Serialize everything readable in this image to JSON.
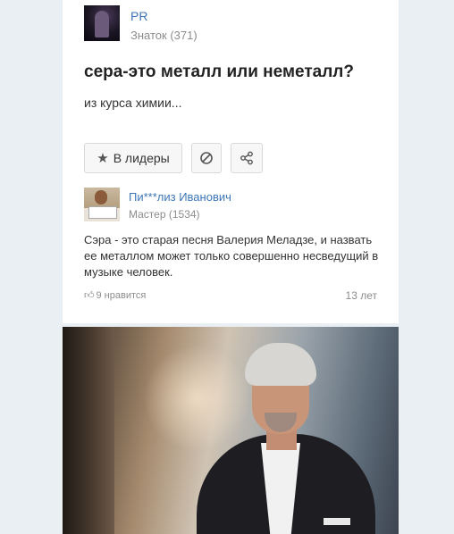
{
  "question": {
    "author": {
      "name": "PR",
      "rank": "Знаток (371)"
    },
    "title": "сера-это металл или неметалл?",
    "subtitle": "из курса химии...",
    "actions": {
      "leaders_label": "В лидеры",
      "leaders_icon": "star-icon",
      "block_icon": "block-icon",
      "share_icon": "share-icon"
    }
  },
  "answer": {
    "author": {
      "name": "Пи***лиз Иванович",
      "rank": "Мастер (1534)"
    },
    "text": "Сэра - это старая песня Валерия Меладзе, и назвать ее металлом может только совершенно несведущий в музыке человек.",
    "likes": "9 нравится",
    "age": "13 лет"
  },
  "colors": {
    "link": "#3d76b8",
    "muted": "#8c8c8c",
    "page_bg": "#e9eff3"
  }
}
